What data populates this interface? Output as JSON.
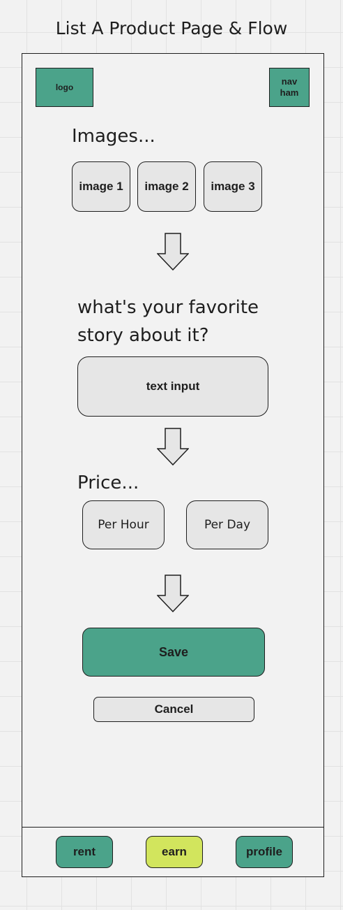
{
  "title": "List A Product Page & Flow",
  "header": {
    "logo_label": "logo",
    "nav_label": "nav\nham"
  },
  "images_section": {
    "heading": "Images...",
    "slots": [
      "image 1",
      "image 2",
      "image 3"
    ]
  },
  "story_section": {
    "heading": "what's your favorite story about it?",
    "input_label": "text input"
  },
  "price_section": {
    "heading": "Price...",
    "options": [
      "Per Hour",
      "Per Day"
    ]
  },
  "actions": {
    "save_label": "Save",
    "cancel_label": "Cancel"
  },
  "bottom_nav": {
    "items": [
      {
        "label": "rent",
        "color": "#4ba38a"
      },
      {
        "label": "earn",
        "color": "#d2e55d"
      },
      {
        "label": "profile",
        "color": "#4ba38a"
      }
    ]
  },
  "colors": {
    "accent": "#4ba38a",
    "highlight": "#d2e55d",
    "neutral_fill": "#e6e6e6",
    "background": "#f2f2f2"
  },
  "icons": {
    "flow_arrow": "arrow-down-icon"
  }
}
